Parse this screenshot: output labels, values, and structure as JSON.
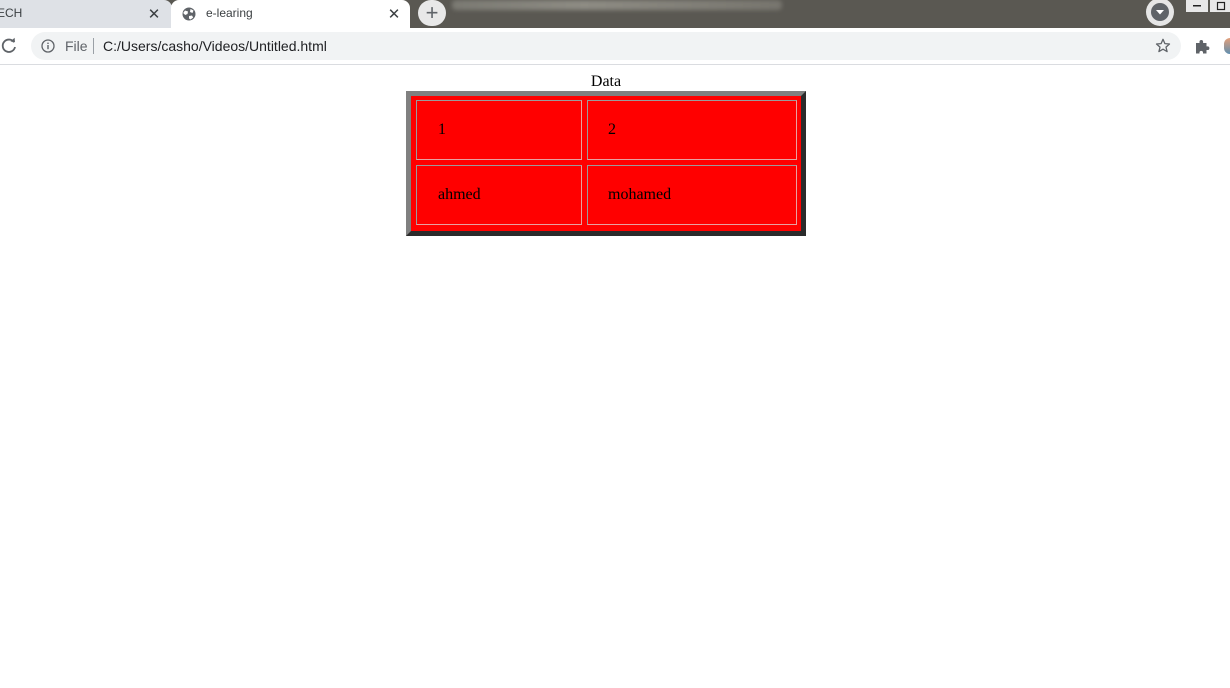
{
  "browser": {
    "tabs": [
      {
        "label": "ECH",
        "active": false
      },
      {
        "label": "e-learing",
        "active": true
      }
    ],
    "close_glyph": "✕",
    "new_tab_glyph": "+",
    "omnibox": {
      "scheme_label": "File",
      "url": "C:/Users/casho/Videos/Untitled.html"
    },
    "icons": {
      "reload": "reload-icon",
      "info": "info-icon",
      "bookmark": "star-icon",
      "extensions": "puzzle-icon",
      "tab_favicon": "globe-icon",
      "profile": "chevron-down-icon"
    }
  },
  "page": {
    "table": {
      "caption": "Data",
      "rows": [
        [
          "1",
          "2"
        ],
        [
          "ahmed",
          "mohamed"
        ]
      ],
      "background_color": "#ff0000"
    }
  }
}
